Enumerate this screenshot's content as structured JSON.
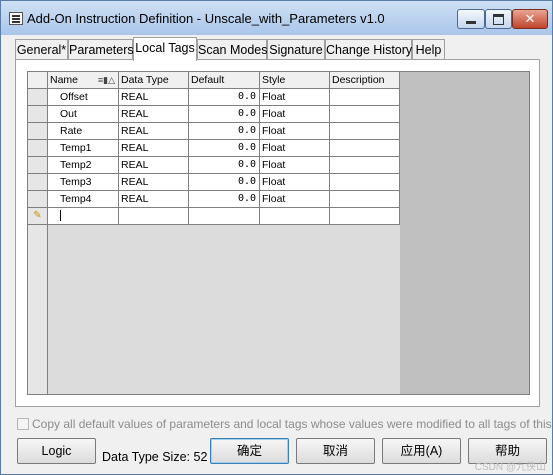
{
  "window": {
    "title": "Add-On Instruction Definition - Unscale_with_Parameters v1.0"
  },
  "tabs": [
    "General*",
    "Parameters",
    "Local Tags",
    "Scan Modes",
    "Signature",
    "Change History",
    "Help"
  ],
  "active_tab": "Local Tags",
  "grid": {
    "columns": [
      "Name",
      "Data Type",
      "Default",
      "Style",
      "Description"
    ],
    "sort_indicator": "≡▮△",
    "rows": [
      {
        "name": "Offset",
        "type": "REAL",
        "default": "0.0",
        "style": "Float",
        "description": ""
      },
      {
        "name": "Out",
        "type": "REAL",
        "default": "0.0",
        "style": "Float",
        "description": ""
      },
      {
        "name": "Rate",
        "type": "REAL",
        "default": "0.0",
        "style": "Float",
        "description": ""
      },
      {
        "name": "Temp1",
        "type": "REAL",
        "default": "0.0",
        "style": "Float",
        "description": ""
      },
      {
        "name": "Temp2",
        "type": "REAL",
        "default": "0.0",
        "style": "Float",
        "description": ""
      },
      {
        "name": "Temp3",
        "type": "REAL",
        "default": "0.0",
        "style": "Float",
        "description": ""
      },
      {
        "name": "Temp4",
        "type": "REAL",
        "default": "0.0",
        "style": "Float",
        "description": ""
      }
    ],
    "new_row_icon": "pencil-icon"
  },
  "copy_defaults": {
    "label": "Copy all default values of parameters and local tags whose values were modified to all tags of this instr",
    "checked": false
  },
  "footer": {
    "logic_label": "Logic",
    "data_type_size": "Data Type Size: 52",
    "ok_label": "确定",
    "cancel_label": "取消",
    "apply_label": "应用(A)",
    "help_label": "帮助"
  },
  "watermark": "CSDN @九侠山",
  "colors": {
    "titlebar": "#a9c6ea",
    "close_button": "#c1442c",
    "grid_filler": "#c0c0c0"
  }
}
